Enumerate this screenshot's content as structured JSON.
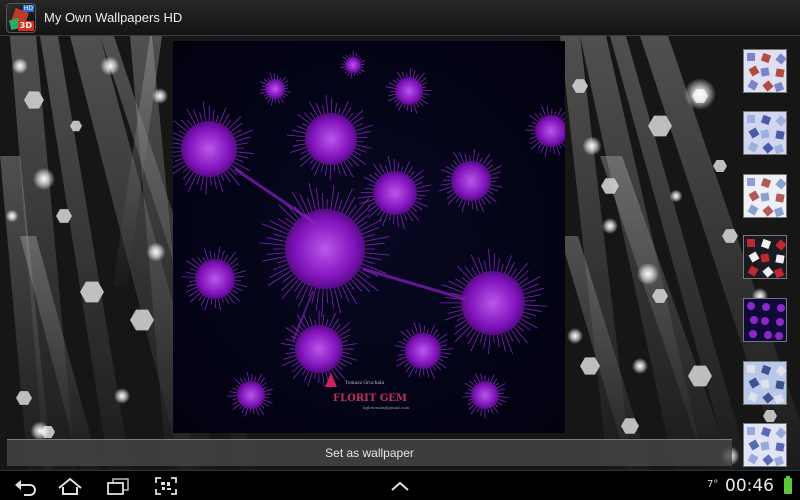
{
  "app": {
    "title": "My Own Wallpapers HD",
    "icon_badges": {
      "top": "HD",
      "bottom": "3D"
    }
  },
  "preview": {
    "credit_line1": "Tomasz Gruchala",
    "credit_logo": "FLORIT GEM",
    "credit_line3": "lightweatx@gmail.com"
  },
  "thumbnails": [
    {
      "name": "thumbnail-1",
      "icon": "wallpaper-thumbnail"
    },
    {
      "name": "thumbnail-2",
      "icon": "wallpaper-thumbnail"
    },
    {
      "name": "thumbnail-3",
      "icon": "wallpaper-thumbnail"
    },
    {
      "name": "thumbnail-4",
      "icon": "wallpaper-thumbnail"
    },
    {
      "name": "thumbnail-5",
      "icon": "wallpaper-thumbnail"
    },
    {
      "name": "thumbnail-6",
      "icon": "wallpaper-thumbnail"
    },
    {
      "name": "thumbnail-7",
      "icon": "wallpaper-thumbnail"
    }
  ],
  "actions": {
    "set_wallpaper_label": "Set as wallpaper"
  },
  "status": {
    "temperature": "7°",
    "time": "00:46"
  },
  "colors": {
    "accent_purple": "#a020e0",
    "battery_green": "#5ec83b"
  }
}
